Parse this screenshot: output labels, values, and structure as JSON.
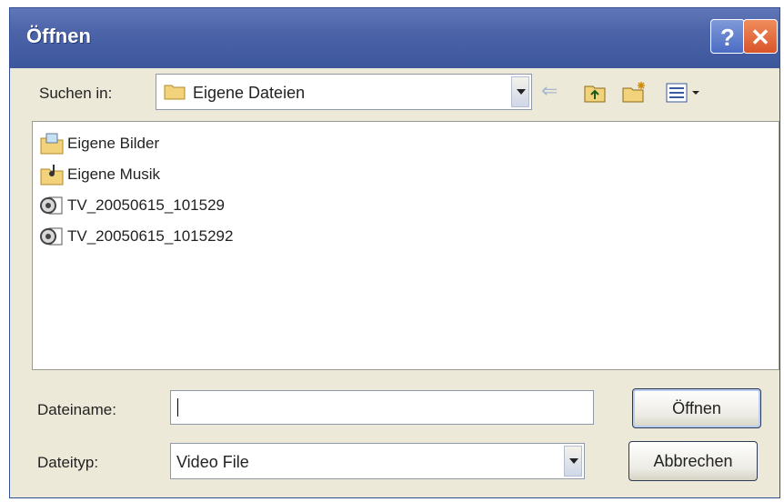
{
  "window": {
    "title": "Öffnen"
  },
  "titlebar": {
    "help_label": "?",
    "close_label": "✕"
  },
  "lookin": {
    "label": "Suchen in:",
    "value": "Eigene Dateien"
  },
  "toolbar": {
    "back_label": "⇐"
  },
  "files": [
    {
      "name": "Eigene Bilder",
      "icon": "pictures-folder-icon"
    },
    {
      "name": "Eigene Musik",
      "icon": "music-folder-icon"
    },
    {
      "name": "TV_20050615_101529",
      "icon": "video-file-icon"
    },
    {
      "name": "TV_20050615_1015292",
      "icon": "video-file-icon"
    }
  ],
  "filename": {
    "label": "Dateiname:",
    "value": ""
  },
  "filetype": {
    "label": "Dateityp:",
    "value": "Video File"
  },
  "buttons": {
    "open_label": "Öffnen",
    "cancel_label": "Abbrechen"
  },
  "colors": {
    "titlebar": "#4c63a8",
    "dialog_bg": "#ede9d8",
    "close": "#d9542b"
  }
}
